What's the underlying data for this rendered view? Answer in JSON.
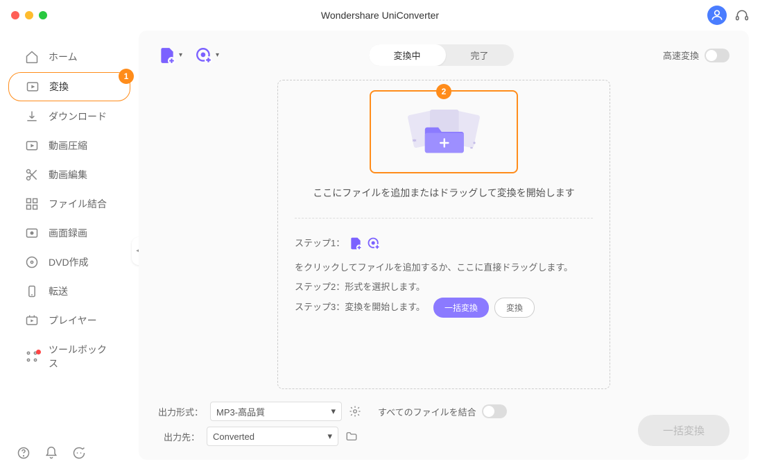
{
  "title": "Wondershare UniConverter",
  "sidebar": {
    "items": [
      {
        "label": "ホーム"
      },
      {
        "label": "変換"
      },
      {
        "label": "ダウンロード"
      },
      {
        "label": "動画圧縮"
      },
      {
        "label": "動画編集"
      },
      {
        "label": "ファイル結合"
      },
      {
        "label": "画面録画"
      },
      {
        "label": "DVD作成"
      },
      {
        "label": "転送"
      },
      {
        "label": "プレイヤー"
      },
      {
        "label": "ツールボックス"
      }
    ],
    "badge1": "1"
  },
  "tabs": {
    "converting": "変換中",
    "done": "完了"
  },
  "speed_label": "高速変換",
  "drop": {
    "badge2": "2",
    "text": "ここにファイルを追加またはドラッグして変換を開始します"
  },
  "steps": {
    "s1a": "ステップ1：",
    "s1b": "をクリックしてファイルを追加するか、ここに直接ドラッグします。",
    "s2": "ステップ2：形式を選択します。",
    "s3": "ステップ3：変換を開始します。",
    "btn_batch": "一括変換",
    "btn_convert": "変換"
  },
  "bottom": {
    "format_label": "出力形式：",
    "format_value": "MP3-高品質",
    "dest_label": "出力先：",
    "dest_value": "Converted",
    "merge_label": "すべてのファイルを結合",
    "big_button": "一括変換"
  }
}
